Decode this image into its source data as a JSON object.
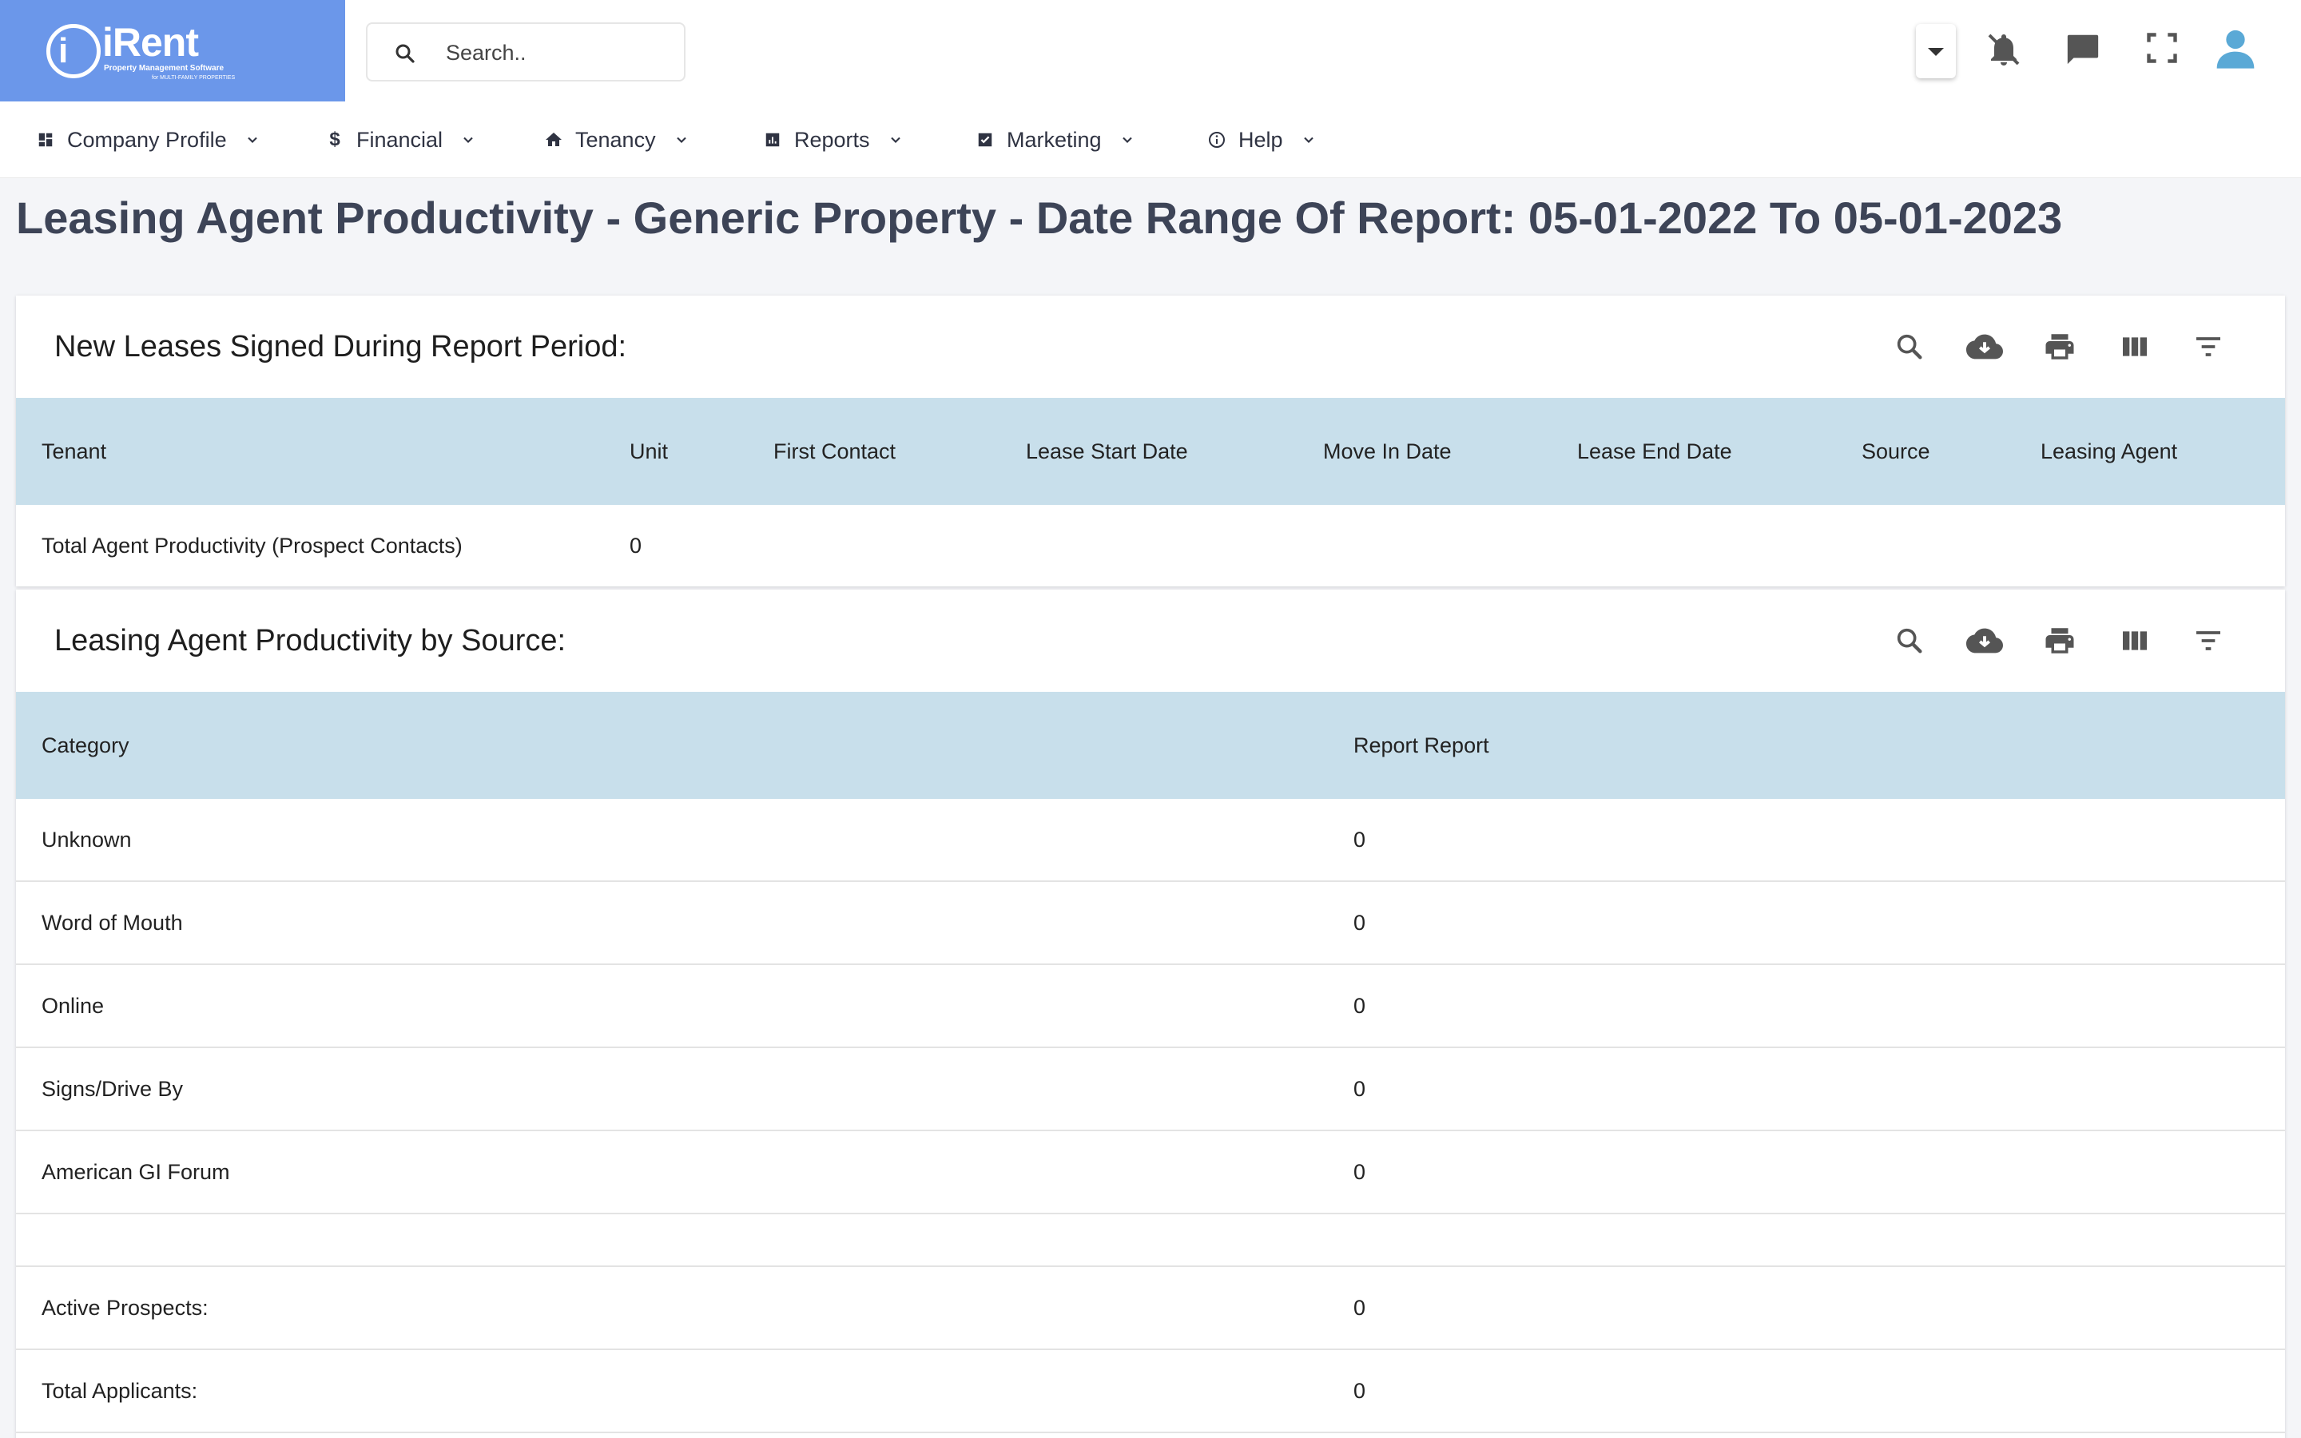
{
  "app": {
    "logo_text": "iRent",
    "logo_mark": "i",
    "logo_tagline": "Property Management Software",
    "logo_subtagline": "for MULTI-FAMILY PROPERTIES"
  },
  "search": {
    "placeholder": "Search..",
    "icon": "search-icon"
  },
  "topbar_icons": [
    "caret-down-icon",
    "bell-off-icon",
    "chat-icon",
    "fullscreen-icon",
    "user-icon"
  ],
  "nav": [
    {
      "label": "Company Profile",
      "icon": "dashboard-icon"
    },
    {
      "label": "Financial",
      "icon": "dollar-icon"
    },
    {
      "label": "Tenancy",
      "icon": "home-icon"
    },
    {
      "label": "Reports",
      "icon": "bar-chart-icon"
    },
    {
      "label": "Marketing",
      "icon": "checkbox-icon"
    },
    {
      "label": "Help",
      "icon": "info-icon"
    }
  ],
  "page_title": "Leasing Agent Productivity - Generic Property - Date Range Of Report: 05-01-2022 To 05-01-2023",
  "table1": {
    "title": "New Leases Signed During Report Period:",
    "columns": [
      "Tenant",
      "Unit",
      "First Contact",
      "Lease Start Date",
      "Move In Date",
      "Lease End Date",
      "Source",
      "Leasing Agent"
    ],
    "rows": [
      [
        "Total Agent Productivity (Prospect Contacts)",
        "0",
        "",
        "",
        "",
        "",
        "",
        ""
      ]
    ]
  },
  "table2": {
    "title": "Leasing Agent Productivity by Source:",
    "columns": [
      "Category",
      "Report Report"
    ],
    "rows": [
      [
        "Unknown",
        "0"
      ],
      [
        "Word of Mouth",
        "0"
      ],
      [
        "Online",
        "0"
      ],
      [
        "Signs/Drive By",
        "0"
      ],
      [
        "American GI Forum",
        "0"
      ],
      [
        "",
        ""
      ],
      [
        "Active Prospects:",
        "0"
      ],
      [
        "Total Applicants:",
        "0"
      ]
    ]
  },
  "toolbar_icons": [
    "search-icon",
    "cloud-download-icon",
    "print-icon",
    "columns-icon",
    "filter-icon"
  ],
  "colors": {
    "logo_bg": "#6b97ea",
    "table_header_bg": "#c8dfeb",
    "title_color": "#3d4457",
    "user_icon": "#5aa9d6"
  }
}
